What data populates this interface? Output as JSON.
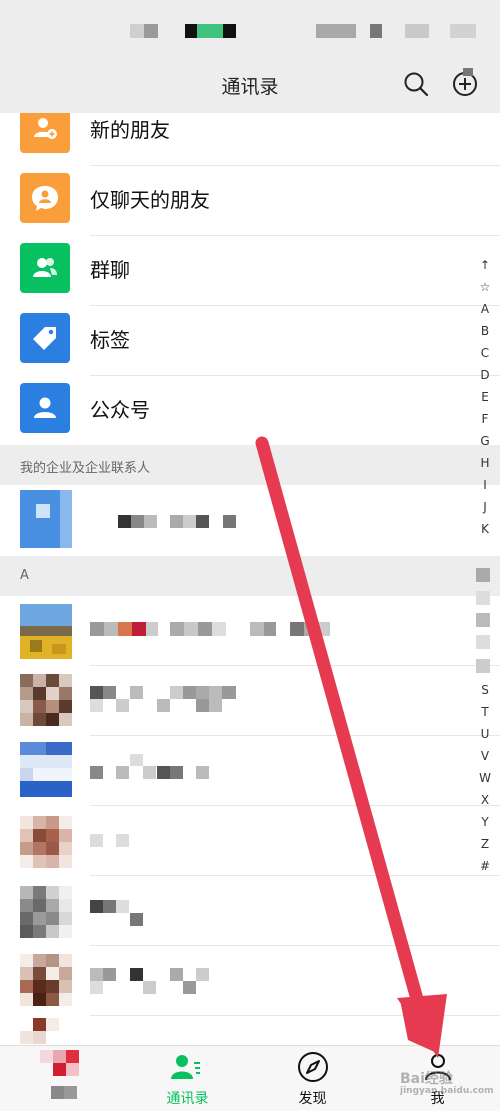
{
  "header": {
    "title": "通讯录",
    "search_icon": "search-icon",
    "add_icon": "add-circle-icon"
  },
  "functions": [
    {
      "label": "新的朋友",
      "icon": "add-friend-icon",
      "color": "#fa9d3b"
    },
    {
      "label": "仅聊天的朋友",
      "icon": "chat-bubble-person-icon",
      "color": "#fa9d3b"
    },
    {
      "label": "群聊",
      "icon": "group-icon",
      "color": "#07c160"
    },
    {
      "label": "标签",
      "icon": "tag-icon",
      "color": "#2b7fe0"
    },
    {
      "label": "公众号",
      "icon": "person-icon",
      "color": "#2b7fe0"
    }
  ],
  "sections": {
    "enterprise": "我的企业及企业联系人",
    "a": "A"
  },
  "alphabet_index": [
    "↑",
    "☆",
    "A",
    "B",
    "C",
    "D",
    "E",
    "F",
    "G",
    "H",
    "I",
    "J",
    "K",
    "R",
    "S",
    "T",
    "U",
    "V",
    "W",
    "X",
    "Y",
    "Z",
    "#"
  ],
  "tabs": [
    {
      "label": "",
      "icon": "chat-icon",
      "active": false
    },
    {
      "label": "通讯录",
      "icon": "contacts-icon",
      "active": true
    },
    {
      "label": "发现",
      "icon": "compass-icon",
      "active": false
    },
    {
      "label": "我",
      "icon": "me-icon",
      "active": false
    }
  ],
  "colors": {
    "accent": "#07c160",
    "arrow": "#e63a50",
    "header_bg": "#ededed"
  },
  "watermark": {
    "text": "Bai经验",
    "subtext": "jingyan.baidu.com"
  }
}
